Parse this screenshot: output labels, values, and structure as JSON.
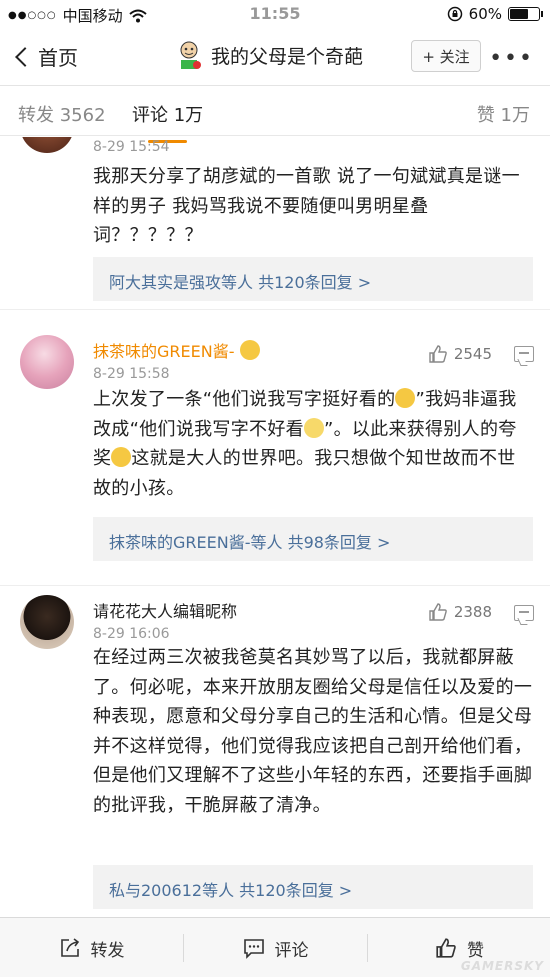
{
  "status_bar": {
    "signal": "●●○○○",
    "carrier": "中国移动",
    "time": "11:55",
    "battery_pct": "60%"
  },
  "nav": {
    "back_label": "首页",
    "title": "我的父母是个奇葩",
    "follow_label": "+ 关注",
    "more": "•••"
  },
  "tabs": {
    "repost": "转发 3562",
    "comments": "评论 1万",
    "likes": "赞 1万"
  },
  "comments": [
    {
      "time": "8-29 15:54",
      "body": "我那天分享了胡彦斌的一首歌 说了一句斌斌真是谜一样的男子 我妈骂我说不要随便叫男明星叠词？？？？？",
      "replies": "阿大其实是强攻等人  共120条回复 >"
    },
    {
      "name": "抹茶味的GREEN酱-",
      "time": "8-29 15:58",
      "likes": "2545",
      "body_parts": [
        "上次发了一条“他们说我写字挺好看的",
        "”我妈非逼我改成“他们说我写字不好看",
        "”。以此来获得别人的夸奖",
        "这就是大人的世界吧。我只想做个知世故而不世故的小孩。"
      ],
      "replies": "抹茶味的GREEN酱-等人  共98条回复 >"
    },
    {
      "name": "请花花大人编辑昵称",
      "time": "8-29 16:06",
      "likes": "2388",
      "body": "在经过两三次被我爸莫名其妙骂了以后，我就都屏蔽了。何必呢，本来开放朋友圈给父母是信任以及爱的一种表现，愿意和父母分享自己的生活和心情。但是父母并不这样觉得，他们觉得我应该把自己剖开给他们看，但是他们又理解不了这些小年轻的东西，还要指手画脚的批评我，干脆屏蔽了清净。",
      "replies": "私与200612等人  共120条回复 >"
    }
  ],
  "bottom": {
    "repost": "转发",
    "comment": "评论",
    "like": "赞"
  },
  "watermark": "GAMERSKY"
}
